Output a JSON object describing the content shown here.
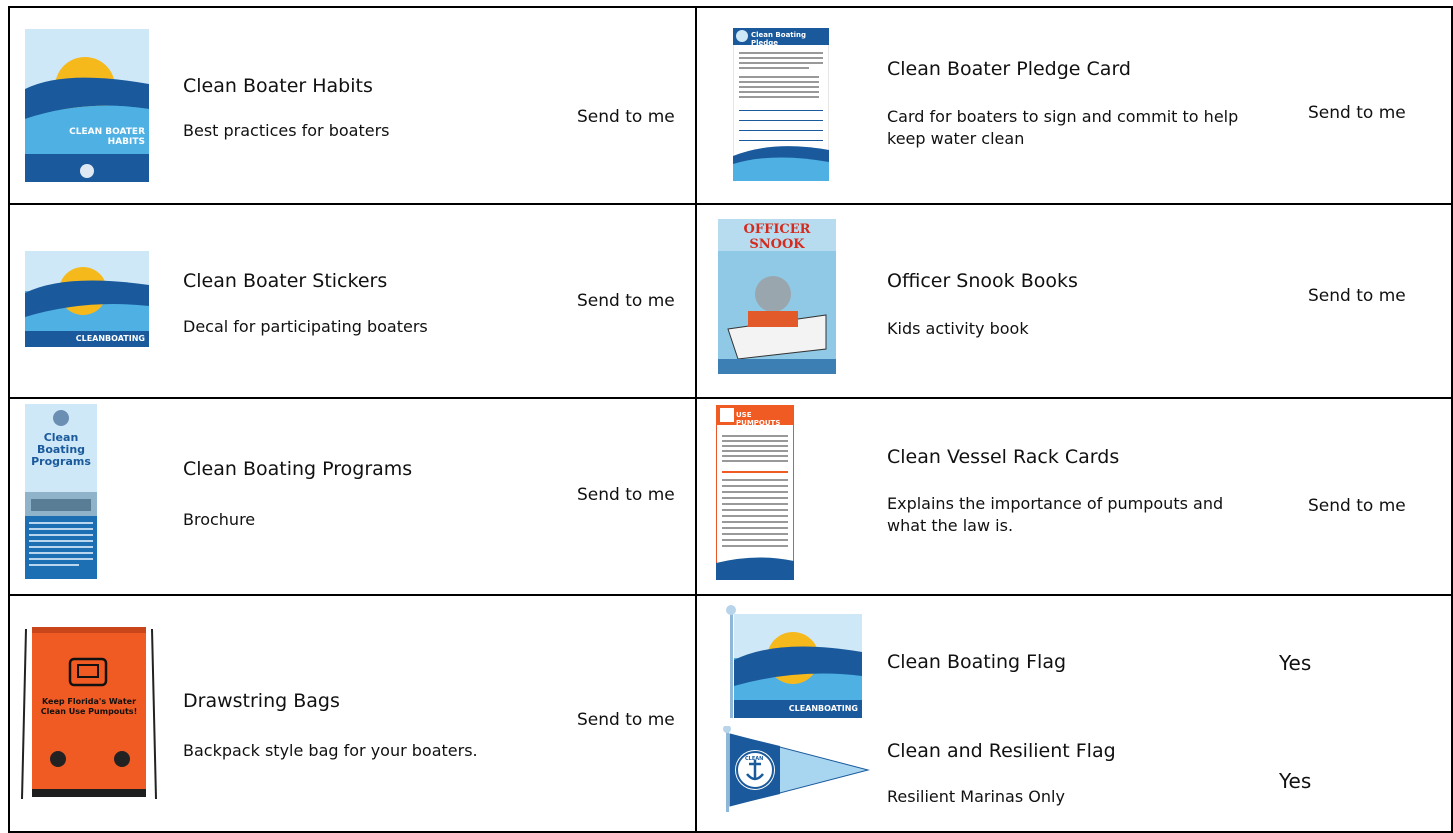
{
  "items": [
    {
      "title": "Clean Boater Habits",
      "desc": "Best practices for boaters",
      "action": "Send to me",
      "thumb_text": "CLEAN BOATER HABITS"
    },
    {
      "title": "Clean Boater Stickers",
      "desc": "Decal for participating boaters",
      "action": "Send to me",
      "thumb_text": "CLEANBOATING"
    },
    {
      "title": "Clean Boating Programs",
      "desc": "Brochure",
      "action": "Send to me",
      "thumb_text": "Clean Boating Programs"
    },
    {
      "title": "Drawstring Bags",
      "desc": "Backpack style bag for your boaters.",
      "action": "Send to me",
      "thumb_text": "Keep Florida's Water Clean Use Pumpouts!"
    },
    {
      "title": "Clean Boater Pledge Card",
      "desc": "Card for boaters to sign and commit to help keep water clean",
      "action": "Send to me",
      "thumb_text": "Clean Boating Pledge"
    },
    {
      "title": "Officer Snook Books",
      "desc": "Kids activity book",
      "action": "Send to me",
      "thumb_text": "OFFICER SNOOK"
    },
    {
      "title": "Clean Vessel Rack Cards",
      "desc": "Explains the importance of  pumpouts and what the law is.",
      "action": "Send to me",
      "thumb_text": "USE PUMPOUTS"
    },
    {
      "title": "Clean Boating Flag",
      "desc": "",
      "action": "Yes",
      "thumb_text": "CLEANBOATING"
    },
    {
      "title": "Clean and Resilient Flag",
      "desc": "Resilient Marinas Only",
      "action": "Yes",
      "thumb_text": "CLEAN"
    }
  ],
  "colors": {
    "sky": "#cfe8f7",
    "sun": "#f6b91c",
    "navy": "#1a5a9c",
    "blue": "#3ea7de",
    "orange": "#f05a23"
  }
}
